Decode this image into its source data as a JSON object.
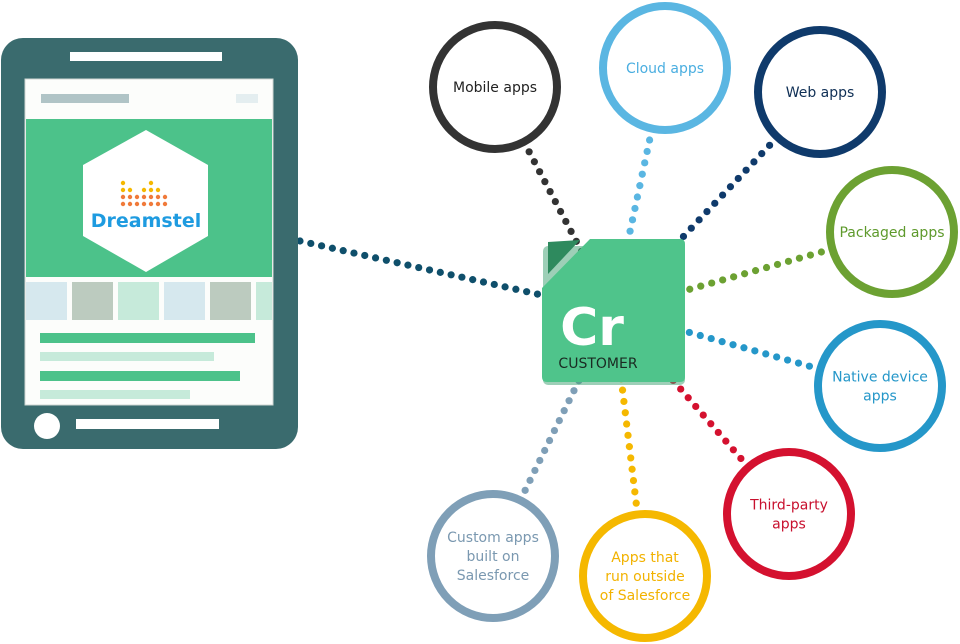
{
  "tablet": {
    "logo_text": "Dreamstel",
    "frame_color": "#3a6b6e",
    "accent_green": "#4cc28a",
    "logo_blue": "#1e9be0"
  },
  "hub": {
    "symbol": "Cr",
    "label": "CUSTOMER",
    "color": "#4fc48b",
    "fold_color": "#2e8a5e"
  },
  "nodes": [
    {
      "id": "mobile-apps",
      "lines": [
        "Mobile apps"
      ],
      "color": "#333333",
      "text_color": "#222222"
    },
    {
      "id": "cloud-apps",
      "lines": [
        "Cloud apps"
      ],
      "color": "#5ab6e2",
      "text_color": "#4aaee0"
    },
    {
      "id": "web-apps",
      "lines": [
        "Web apps"
      ],
      "color": "#0f3a6b",
      "text_color": "#0f2f55"
    },
    {
      "id": "packaged-apps",
      "lines": [
        "Packaged apps"
      ],
      "color": "#6ca132",
      "text_color": "#5e9a2c"
    },
    {
      "id": "native-device-apps",
      "lines": [
        "Native device",
        "apps"
      ],
      "color": "#2597c9",
      "text_color": "#2597c9"
    },
    {
      "id": "third-party-apps",
      "lines": [
        "Third-party",
        "apps"
      ],
      "color": "#d4112f",
      "text_color": "#c8102e"
    },
    {
      "id": "apps-outside-salesforce",
      "lines": [
        "Apps that",
        "run outside",
        "of Salesforce"
      ],
      "color": "#f5b800",
      "text_color": "#f2b200"
    },
    {
      "id": "custom-apps-salesforce",
      "lines": [
        "Custom apps",
        "built on",
        "Salesforce"
      ],
      "color": "#7f9fb7",
      "text_color": "#7a98b0"
    }
  ],
  "tablet_link_color": "#0f4f6b"
}
